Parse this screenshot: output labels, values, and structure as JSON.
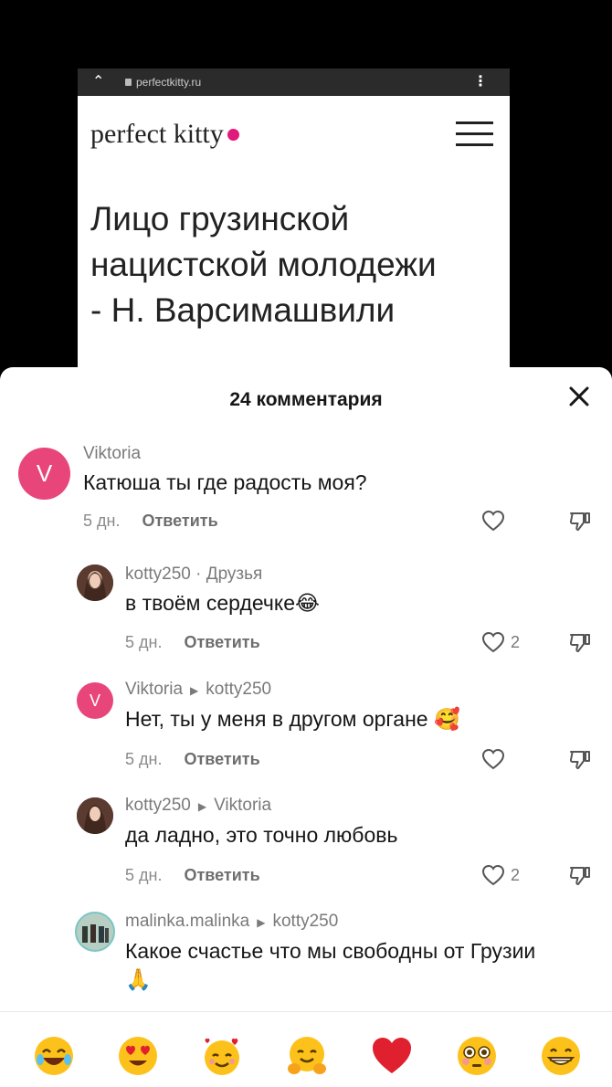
{
  "video": {
    "url": "perfectkitty.ru",
    "site_name": "perfect kitty",
    "headline_lines": [
      "Лицо грузинской",
      "нацистской молодежи",
      "- Н. Варсимашвили"
    ]
  },
  "sheet": {
    "title": "24 комментария"
  },
  "comments": [
    {
      "author": "Viktoria",
      "reply_to": "",
      "tag": "",
      "text": "Катюша ты где радость моя?",
      "time": "5 дн.",
      "reply": "Ответить",
      "likes": "",
      "avatar_letter": "V"
    },
    {
      "author": "kotty250",
      "reply_to": "",
      "tag": "· Друзья",
      "text": "в твоём сердечке😂",
      "time": "5 дн.",
      "reply": "Ответить",
      "likes": "2",
      "avatar_letter": ""
    },
    {
      "author": "Viktoria",
      "reply_to": "kotty250",
      "tag": "",
      "text": "Нет, ты у меня в другом органе 🥰",
      "time": "5 дн.",
      "reply": "Ответить",
      "likes": "",
      "avatar_letter": "V"
    },
    {
      "author": "kotty250",
      "reply_to": "Viktoria",
      "tag": "",
      "text": "да ладно, это точно любовь",
      "time": "5 дн.",
      "reply": "Ответить",
      "likes": "2",
      "avatar_letter": ""
    },
    {
      "author": "malinka.malinka",
      "reply_to": "kotty250",
      "tag": "",
      "text": "Какое счастье что мы свободны от Грузии 🙏",
      "time": "",
      "reply": "",
      "likes": "",
      "avatar_letter": ""
    }
  ],
  "emoji_bar": [
    "joy",
    "heart-eyes",
    "smiling-hearts",
    "hugging",
    "red-heart",
    "flushed",
    "grin"
  ],
  "colors": {
    "accent_pink": "#e21a7b",
    "avatar_v": "#e8467a"
  }
}
